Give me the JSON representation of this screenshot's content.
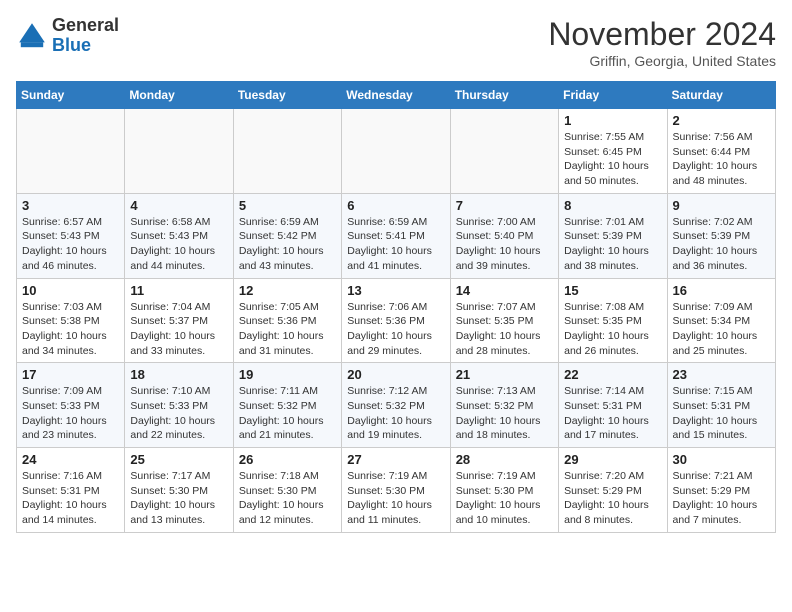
{
  "header": {
    "logo_line1": "General",
    "logo_line2": "Blue",
    "month": "November 2024",
    "location": "Griffin, Georgia, United States"
  },
  "weekdays": [
    "Sunday",
    "Monday",
    "Tuesday",
    "Wednesday",
    "Thursday",
    "Friday",
    "Saturday"
  ],
  "weeks": [
    [
      {
        "day": "",
        "info": ""
      },
      {
        "day": "",
        "info": ""
      },
      {
        "day": "",
        "info": ""
      },
      {
        "day": "",
        "info": ""
      },
      {
        "day": "",
        "info": ""
      },
      {
        "day": "1",
        "info": "Sunrise: 7:55 AM\nSunset: 6:45 PM\nDaylight: 10 hours\nand 50 minutes."
      },
      {
        "day": "2",
        "info": "Sunrise: 7:56 AM\nSunset: 6:44 PM\nDaylight: 10 hours\nand 48 minutes."
      }
    ],
    [
      {
        "day": "3",
        "info": "Sunrise: 6:57 AM\nSunset: 5:43 PM\nDaylight: 10 hours\nand 46 minutes."
      },
      {
        "day": "4",
        "info": "Sunrise: 6:58 AM\nSunset: 5:43 PM\nDaylight: 10 hours\nand 44 minutes."
      },
      {
        "day": "5",
        "info": "Sunrise: 6:59 AM\nSunset: 5:42 PM\nDaylight: 10 hours\nand 43 minutes."
      },
      {
        "day": "6",
        "info": "Sunrise: 6:59 AM\nSunset: 5:41 PM\nDaylight: 10 hours\nand 41 minutes."
      },
      {
        "day": "7",
        "info": "Sunrise: 7:00 AM\nSunset: 5:40 PM\nDaylight: 10 hours\nand 39 minutes."
      },
      {
        "day": "8",
        "info": "Sunrise: 7:01 AM\nSunset: 5:39 PM\nDaylight: 10 hours\nand 38 minutes."
      },
      {
        "day": "9",
        "info": "Sunrise: 7:02 AM\nSunset: 5:39 PM\nDaylight: 10 hours\nand 36 minutes."
      }
    ],
    [
      {
        "day": "10",
        "info": "Sunrise: 7:03 AM\nSunset: 5:38 PM\nDaylight: 10 hours\nand 34 minutes."
      },
      {
        "day": "11",
        "info": "Sunrise: 7:04 AM\nSunset: 5:37 PM\nDaylight: 10 hours\nand 33 minutes."
      },
      {
        "day": "12",
        "info": "Sunrise: 7:05 AM\nSunset: 5:36 PM\nDaylight: 10 hours\nand 31 minutes."
      },
      {
        "day": "13",
        "info": "Sunrise: 7:06 AM\nSunset: 5:36 PM\nDaylight: 10 hours\nand 29 minutes."
      },
      {
        "day": "14",
        "info": "Sunrise: 7:07 AM\nSunset: 5:35 PM\nDaylight: 10 hours\nand 28 minutes."
      },
      {
        "day": "15",
        "info": "Sunrise: 7:08 AM\nSunset: 5:35 PM\nDaylight: 10 hours\nand 26 minutes."
      },
      {
        "day": "16",
        "info": "Sunrise: 7:09 AM\nSunset: 5:34 PM\nDaylight: 10 hours\nand 25 minutes."
      }
    ],
    [
      {
        "day": "17",
        "info": "Sunrise: 7:09 AM\nSunset: 5:33 PM\nDaylight: 10 hours\nand 23 minutes."
      },
      {
        "day": "18",
        "info": "Sunrise: 7:10 AM\nSunset: 5:33 PM\nDaylight: 10 hours\nand 22 minutes."
      },
      {
        "day": "19",
        "info": "Sunrise: 7:11 AM\nSunset: 5:32 PM\nDaylight: 10 hours\nand 21 minutes."
      },
      {
        "day": "20",
        "info": "Sunrise: 7:12 AM\nSunset: 5:32 PM\nDaylight: 10 hours\nand 19 minutes."
      },
      {
        "day": "21",
        "info": "Sunrise: 7:13 AM\nSunset: 5:32 PM\nDaylight: 10 hours\nand 18 minutes."
      },
      {
        "day": "22",
        "info": "Sunrise: 7:14 AM\nSunset: 5:31 PM\nDaylight: 10 hours\nand 17 minutes."
      },
      {
        "day": "23",
        "info": "Sunrise: 7:15 AM\nSunset: 5:31 PM\nDaylight: 10 hours\nand 15 minutes."
      }
    ],
    [
      {
        "day": "24",
        "info": "Sunrise: 7:16 AM\nSunset: 5:31 PM\nDaylight: 10 hours\nand 14 minutes."
      },
      {
        "day": "25",
        "info": "Sunrise: 7:17 AM\nSunset: 5:30 PM\nDaylight: 10 hours\nand 13 minutes."
      },
      {
        "day": "26",
        "info": "Sunrise: 7:18 AM\nSunset: 5:30 PM\nDaylight: 10 hours\nand 12 minutes."
      },
      {
        "day": "27",
        "info": "Sunrise: 7:19 AM\nSunset: 5:30 PM\nDaylight: 10 hours\nand 11 minutes."
      },
      {
        "day": "28",
        "info": "Sunrise: 7:19 AM\nSunset: 5:30 PM\nDaylight: 10 hours\nand 10 minutes."
      },
      {
        "day": "29",
        "info": "Sunrise: 7:20 AM\nSunset: 5:29 PM\nDaylight: 10 hours\nand 8 minutes."
      },
      {
        "day": "30",
        "info": "Sunrise: 7:21 AM\nSunset: 5:29 PM\nDaylight: 10 hours\nand 7 minutes."
      }
    ]
  ]
}
